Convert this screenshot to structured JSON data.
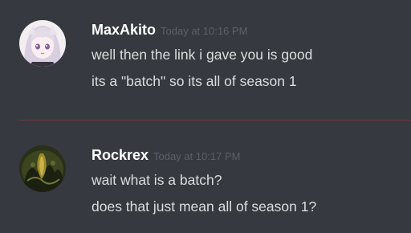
{
  "messages": [
    {
      "username": "MaxAkito",
      "timestamp": "Today at 10:16 PM",
      "avatar": "anime-girl-avatar",
      "lines": [
        "well then the link i gave you is good",
        "its a \"batch\" so its all of season 1"
      ]
    },
    {
      "username": "Rockrex",
      "timestamp": "Today at 10:17 PM",
      "avatar": "dark-creature-avatar",
      "lines": [
        "wait what is a batch?",
        "does that just mean all of season 1?"
      ]
    }
  ],
  "colors": {
    "background": "#36393f",
    "username": "#ffffff",
    "message_text": "#dcddde",
    "timestamp": "#5d6067",
    "new_message_divider": "#6e3b40"
  }
}
